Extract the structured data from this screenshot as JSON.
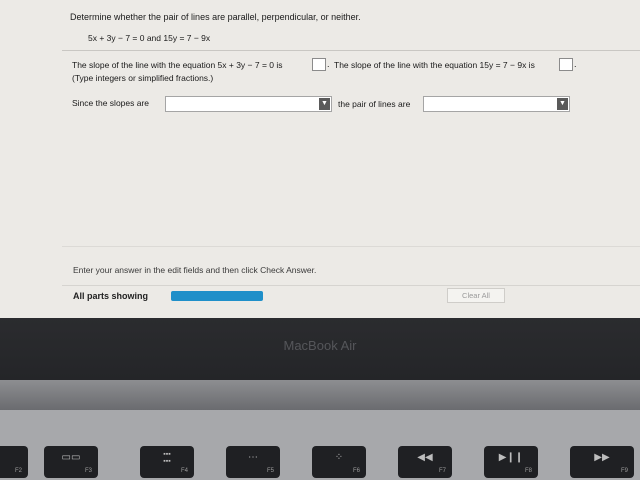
{
  "question": {
    "title": "Determine whether the pair of lines are parallel, perpendicular, or neither.",
    "equations": "5x + 3y − 7 = 0 and 15y = 7 − 9x"
  },
  "part1": {
    "prompt_a": "The slope of the line with the equation 5x + 3y − 7 = 0 is",
    "prompt_b": "The slope of the line with the equation 15y = 7 − 9x is",
    "hint": "(Type integers or simplified fractions.)",
    "answer_a": "",
    "answer_b": ""
  },
  "part2": {
    "since_label": "Since the slopes are",
    "pair_label": "the pair of lines are",
    "dropdown_a_value": "",
    "dropdown_b_value": ""
  },
  "footer": {
    "instructions": "Enter your answer in the edit fields and then click Check Answer.",
    "parts_label": "All parts showing",
    "progress_fraction": 1.0,
    "clear_label": "Clear All",
    "progress_color": "#1f8fc9"
  },
  "laptop": {
    "brand": "MacBook Air",
    "keys": [
      {
        "icon": "",
        "label": "F2"
      },
      {
        "icon": "mission-control-icon",
        "label": "F3"
      },
      {
        "icon": "launchpad-icon",
        "label": "F4"
      },
      {
        "icon": "keyboard-light-down-icon",
        "label": "F5"
      },
      {
        "icon": "keyboard-light-up-icon",
        "label": "F6"
      },
      {
        "icon": "rewind-icon",
        "label": "F7"
      },
      {
        "icon": "play-pause-icon",
        "label": "F8"
      },
      {
        "icon": "fast-forward-icon",
        "label": "F9"
      }
    ]
  }
}
